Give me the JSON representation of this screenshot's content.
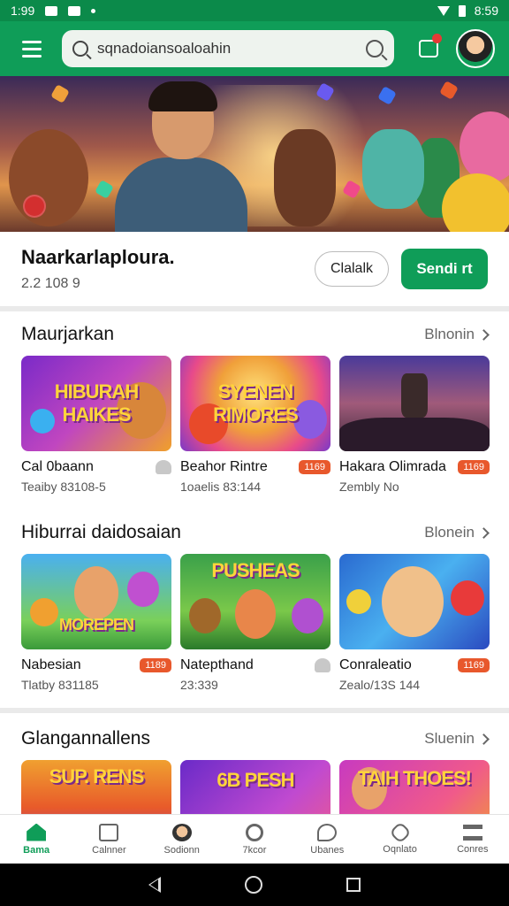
{
  "status_bar": {
    "time_left": "1:99",
    "time_right": "8:59"
  },
  "search": {
    "placeholder": "sqnadoiansoaloahin"
  },
  "profile": {
    "title": "Naarkarlaploura.",
    "subtitle": "2.2 108 9",
    "outline_button": "Clalalk",
    "primary_button": "Sendi rt"
  },
  "sections": [
    {
      "title": "Maurjarkan",
      "more": "Blnonin",
      "cards": [
        {
          "art_text": "HIBURAH HAIKES",
          "name": "Cal 0baann",
          "meta": "Teaiby 83108-5",
          "badge": ""
        },
        {
          "art_text": "SYENEN RIMORES",
          "name": "Beahor Rintre",
          "meta": "1oaelis 83:144",
          "badge": "1169"
        },
        {
          "art_text": "",
          "name": "Hakara Olimrada",
          "meta": "Zembly No",
          "badge": "1169"
        }
      ]
    },
    {
      "title": "Hiburrai daidosaian",
      "more": "Blonein",
      "cards": [
        {
          "art_text": "MOREPEN",
          "name": "Nabesian",
          "meta": "Tlatby 831185",
          "badge": "1189"
        },
        {
          "art_text": "PUSHEAS",
          "name": "Natepthand",
          "meta": "23:339",
          "badge": ""
        },
        {
          "art_text": "",
          "name": "Conraleatio",
          "meta": "Zealo/13S 144",
          "badge": "1169"
        }
      ]
    },
    {
      "title": "Glangannallens",
      "more": "Sluenin",
      "cards": [
        {
          "art_text": "SUP. RENS",
          "name": "",
          "meta": "",
          "badge": ""
        },
        {
          "art_text": "6B PESH",
          "name": "",
          "meta": "",
          "badge": ""
        },
        {
          "art_text": "TAIH THOES!",
          "name": "",
          "meta": "",
          "badge": ""
        }
      ]
    }
  ],
  "bottom_nav": [
    "Bama",
    "Calnner",
    "Sodionn",
    "7kcor",
    "Ubanes",
    "Oqnlato",
    "Conres"
  ],
  "colors": {
    "accent": "#0f9d58",
    "badge": "#e8582c"
  }
}
